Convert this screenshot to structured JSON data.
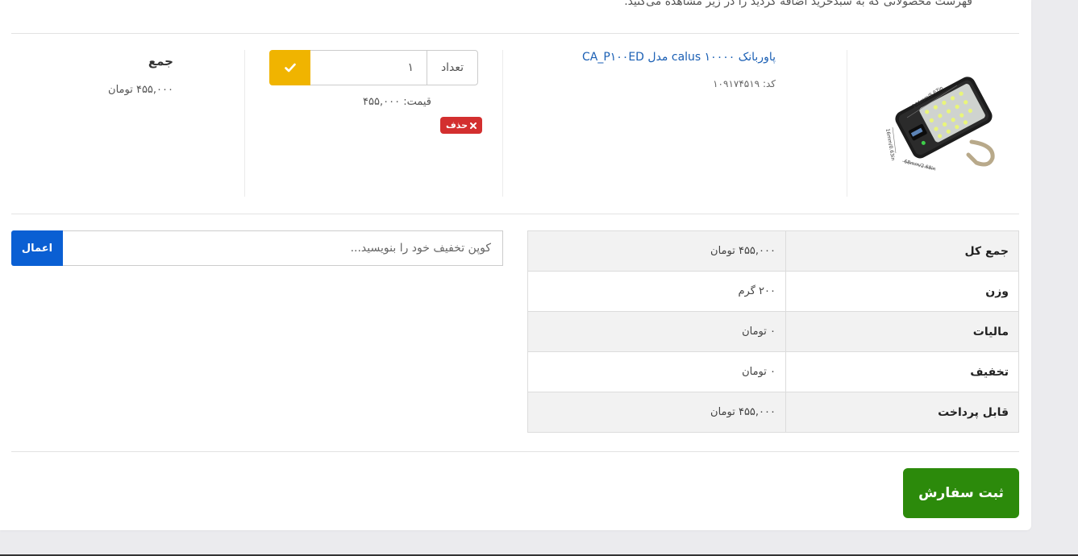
{
  "intro_text": "فهرست محصولاتی که به سبدخرید اضافه کردید را در زیر مشاهده می‌کنید.",
  "product": {
    "title": "پاوربانک calus ۱۰۰۰۰ مدل CA_P۱۰۰ED",
    "code": "کد: ۱۰۹۱۷۴۵۱۹",
    "quantity_label": "تعداد",
    "quantity_value": "۱",
    "confirm_icon": "check-icon",
    "unit_price": "قیمت: ۴۵۵,۰۰۰",
    "delete_label": "حذف",
    "delete_icon": "times-icon",
    "image_labels": {
      "width": "144mm/5.67in",
      "height": "68mm/2.68in",
      "depth": "16mm/0.63in"
    }
  },
  "line_sum": {
    "label": "جمع",
    "value": "۴۵۵,۰۰۰ تومان"
  },
  "totals": [
    {
      "label": "جمع کل",
      "value": "۴۵۵,۰۰۰ تومان"
    },
    {
      "label": "وزن",
      "value": "۲۰۰ گرم"
    },
    {
      "label": "مالیات",
      "value": "۰ تومان"
    },
    {
      "label": "تخفیف",
      "value": "۰ تومان"
    },
    {
      "label": "قابل پرداخت",
      "value": "۴۵۵,۰۰۰ تومان"
    }
  ],
  "coupon": {
    "placeholder": "کوپن تخفیف خود را بنویسید...",
    "apply_label": "اعمال"
  },
  "submit_label": "ثبت سفارش",
  "colors": {
    "link": "#1a5fb4",
    "confirm": "#f0b400",
    "delete": "#d32f2f",
    "apply": "#0a5fd3",
    "submit": "#2c8a0b"
  }
}
